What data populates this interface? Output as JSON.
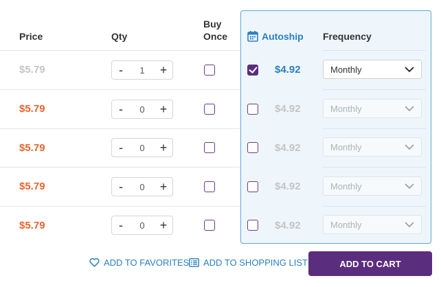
{
  "headers": {
    "price": "Price",
    "qty": "Qty",
    "buy_once_line1": "Buy",
    "buy_once_line2": "Once",
    "autoship": "Autoship",
    "frequency": "Frequency"
  },
  "rows": [
    {
      "price": "$5.79",
      "qty": "1",
      "buy_once_checked": false,
      "autoship_checked": true,
      "autoship_price": "$4.92",
      "frequency": "Monthly"
    },
    {
      "price": "$5.79",
      "qty": "0",
      "buy_once_checked": false,
      "autoship_checked": false,
      "autoship_price": "$4.92",
      "frequency": "Monthly"
    },
    {
      "price": "$5.79",
      "qty": "0",
      "buy_once_checked": false,
      "autoship_checked": false,
      "autoship_price": "$4.92",
      "frequency": "Monthly"
    },
    {
      "price": "$5.79",
      "qty": "0",
      "buy_once_checked": false,
      "autoship_checked": false,
      "autoship_price": "$4.92",
      "frequency": "Monthly"
    },
    {
      "price": "$5.79",
      "qty": "0",
      "buy_once_checked": false,
      "autoship_checked": false,
      "autoship_price": "$4.92",
      "frequency": "Monthly"
    }
  ],
  "qty_minus": "-",
  "qty_plus": "+",
  "footer": {
    "favorites": "ADD TO FAVORITES",
    "shopping_list": "ADD TO SHOPPING LIST",
    "add_to_cart": "ADD TO CART"
  },
  "colors": {
    "price_active": "#e8642c",
    "price_muted": "#c4c4c4",
    "autoship_active": "#2a7fc1",
    "autoship_muted": "#c4c4c4",
    "accent_purple": "#5b2d7e",
    "link_blue": "#2a7fc1"
  }
}
